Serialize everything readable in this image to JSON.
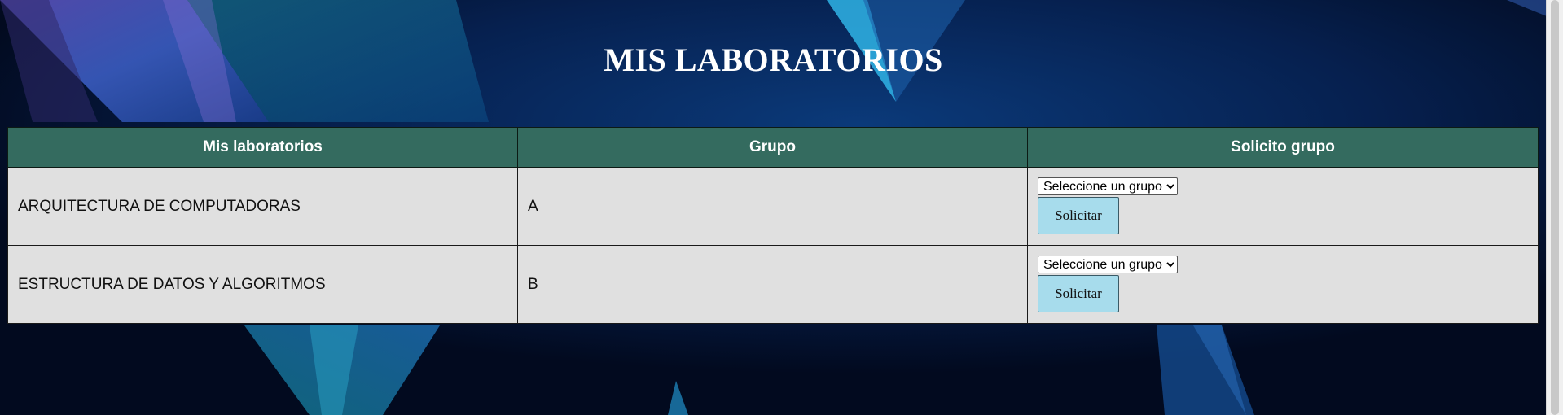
{
  "page": {
    "title": "MIS LABORATORIOS"
  },
  "table": {
    "headers": [
      "Mis laboratorios",
      "Grupo",
      "Solicito grupo"
    ],
    "rows": [
      {
        "lab": "ARQUITECTURA DE COMPUTADORAS",
        "grupo": "A",
        "select_value": "Seleccione un grupo",
        "button_label": "Solicitar"
      },
      {
        "lab": "ESTRUCTURA DE DATOS Y ALGORITMOS",
        "grupo": "B",
        "select_value": "Seleccione un grupo",
        "button_label": "Solicitar"
      }
    ]
  },
  "colors": {
    "header_bg": "#346b5f",
    "row_bg": "#e0e0e0",
    "button_bg": "#a7dcec",
    "page_bg": "#04122e"
  }
}
